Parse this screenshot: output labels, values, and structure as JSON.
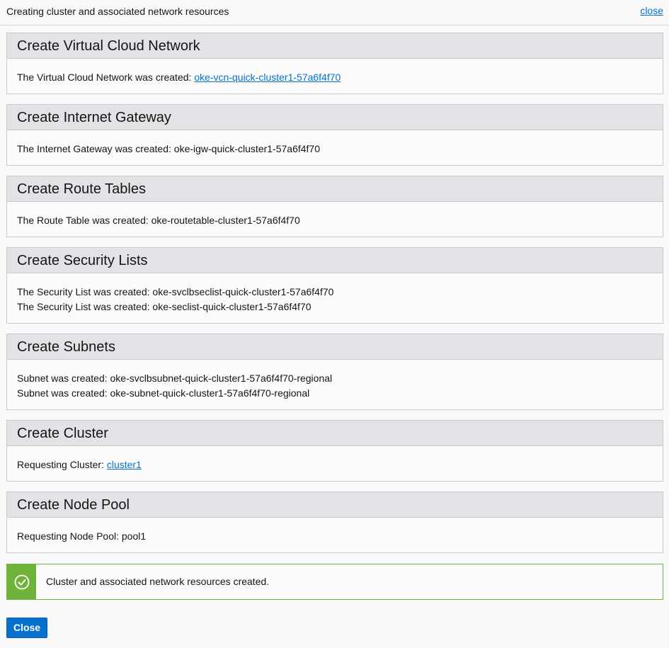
{
  "header": {
    "title": "Creating cluster and associated network resources",
    "close_link": "close"
  },
  "sections": [
    {
      "heading": "Create Virtual Cloud Network",
      "lines": [
        {
          "text": "The Virtual Cloud Network was created: ",
          "link": "oke-vcn-quick-cluster1-57a6f4f70"
        }
      ]
    },
    {
      "heading": "Create Internet Gateway",
      "lines": [
        {
          "text": "The Internet Gateway was created: oke-igw-quick-cluster1-57a6f4f70"
        }
      ]
    },
    {
      "heading": "Create Route Tables",
      "lines": [
        {
          "text": "The Route Table was created: oke-routetable-cluster1-57a6f4f70"
        }
      ]
    },
    {
      "heading": "Create Security Lists",
      "lines": [
        {
          "text": "The Security List was created: oke-svclbseclist-quick-cluster1-57a6f4f70"
        },
        {
          "text": "The Security List was created: oke-seclist-quick-cluster1-57a6f4f70"
        }
      ]
    },
    {
      "heading": "Create Subnets",
      "lines": [
        {
          "text": "Subnet was created: oke-svclbsubnet-quick-cluster1-57a6f4f70-regional"
        },
        {
          "text": "Subnet was created: oke-subnet-quick-cluster1-57a6f4f70-regional"
        }
      ]
    },
    {
      "heading": "Create Cluster",
      "lines": [
        {
          "text": "Requesting Cluster: ",
          "link": "cluster1"
        }
      ]
    },
    {
      "heading": "Create Node Pool",
      "lines": [
        {
          "text": "Requesting Node Pool: pool1"
        }
      ]
    }
  ],
  "success": {
    "icon": "check-circle-icon",
    "message": "Cluster and associated network resources created.",
    "color": "#6fb33a"
  },
  "footer": {
    "close_button": "Close"
  },
  "colors": {
    "link": "#0572ce",
    "button": "#0572ce",
    "panel_header": "#e1e3e6"
  }
}
